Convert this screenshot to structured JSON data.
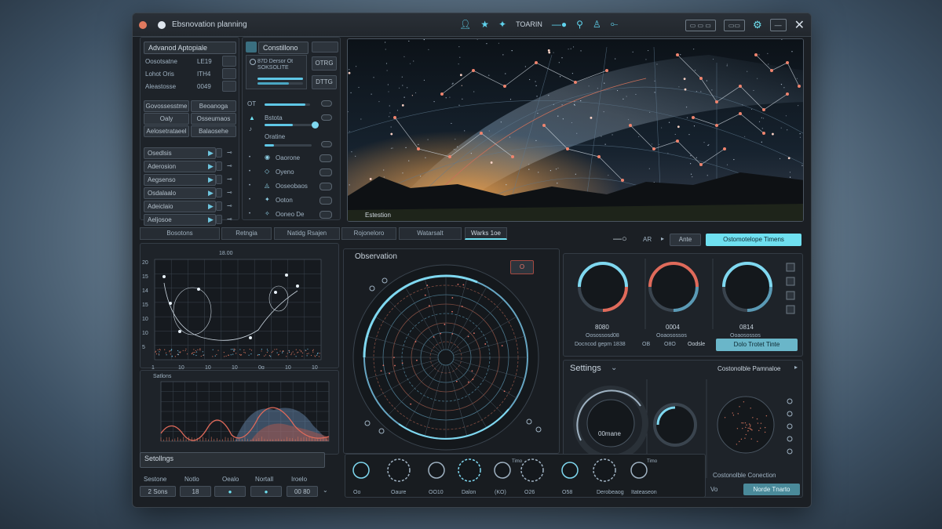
{
  "window": {
    "title": "Ebsnovation planning"
  },
  "toolbar": {
    "tool_label": "TOARIN",
    "box1": "▭ ▭ ▭",
    "box2": "▭▭"
  },
  "left_top": {
    "header": "Advanod Aptopiale",
    "rows": [
      {
        "label": "Oosotsatne",
        "value": "LE19"
      },
      {
        "label": "Lohot Oris",
        "value": "ITH4"
      },
      {
        "label": "Aleastosse",
        "value": "0049"
      }
    ],
    "grid_buttons": [
      [
        "Govossesstme",
        "Beoanoga"
      ],
      [
        "Oaly",
        "Osseumaos"
      ],
      [
        "Aelosetrataeel",
        "Balaosehe"
      ]
    ],
    "play_rows": [
      "Osedlsis",
      "Aderosion",
      "Aegsenso",
      "Osdalaalo",
      "Adeiclaio",
      "Aeljosoe"
    ]
  },
  "controls": {
    "header": "Constillono",
    "preview_text": "87D Dersor Ot",
    "preview_sub": "SOKSOLITE",
    "side_buttons": [
      "OTRG",
      "DTTG"
    ],
    "slider_label_a": "OT",
    "slider_label_b": "Bstota",
    "slider_label_c": "Oratine",
    "list": [
      "Oaorone",
      "Oyeno",
      "Ooseobaos",
      "Ooton",
      "Ooneo De"
    ]
  },
  "sky": {
    "caption": "Estestion"
  },
  "tabs": [
    "Bosotons",
    "Retngia",
    "Natidg Rsajen",
    "Rojoneloro",
    "Watarsalt",
    "Warks 1oe"
  ],
  "right_toolbar": {
    "label_a": "AR",
    "label_b": "Ante",
    "highlight": "Ostomotelope Timens"
  },
  "chart_top": {
    "top_tick": "18.00",
    "y_ticks": [
      "20",
      "15",
      "14",
      "15",
      "10",
      "10",
      "5"
    ],
    "x_ticks": [
      "1",
      "10",
      "10",
      "10",
      "0g",
      "10",
      "10"
    ]
  },
  "chart_bottom": {
    "title": "Satlons"
  },
  "left_bottom": {
    "settings_label": "Setollngs",
    "labels": [
      "Sestone",
      "Notlo",
      "Oealo",
      "Nortall",
      "Iroelo"
    ],
    "values": [
      "2 Sons",
      "18",
      "",
      "",
      "00 80"
    ]
  },
  "observation": {
    "title": "Observation",
    "top_right": "O"
  },
  "timers": {
    "gauges": [
      {
        "value": "8080",
        "label": "Oosossosd08"
      },
      {
        "value": "0004",
        "label": "Ooaosossos"
      },
      {
        "value": "0814",
        "label": "Ooaosossos"
      }
    ],
    "row_text": "Docncod gepm 1838",
    "row_vals": [
      "OB",
      "O8O",
      "Oodsle"
    ],
    "row_button": "Dolo Trotet Tinte"
  },
  "settings": {
    "title": "Settings",
    "right_title": "Costonolble Pamnaloe",
    "dial_center": "00mane",
    "bottom_caption": "Costonolble Conection",
    "small_btn": "Norde Tnarto",
    "small_label": "Vo"
  },
  "bottom_dials": {
    "labels": [
      "Oo",
      "Oaure",
      "OO10",
      "Dalon",
      "(KO)",
      "O26",
      "O58",
      "Derobeaog",
      "Itateaseon"
    ],
    "top_labels": [
      "Timo",
      "Timo"
    ]
  }
}
